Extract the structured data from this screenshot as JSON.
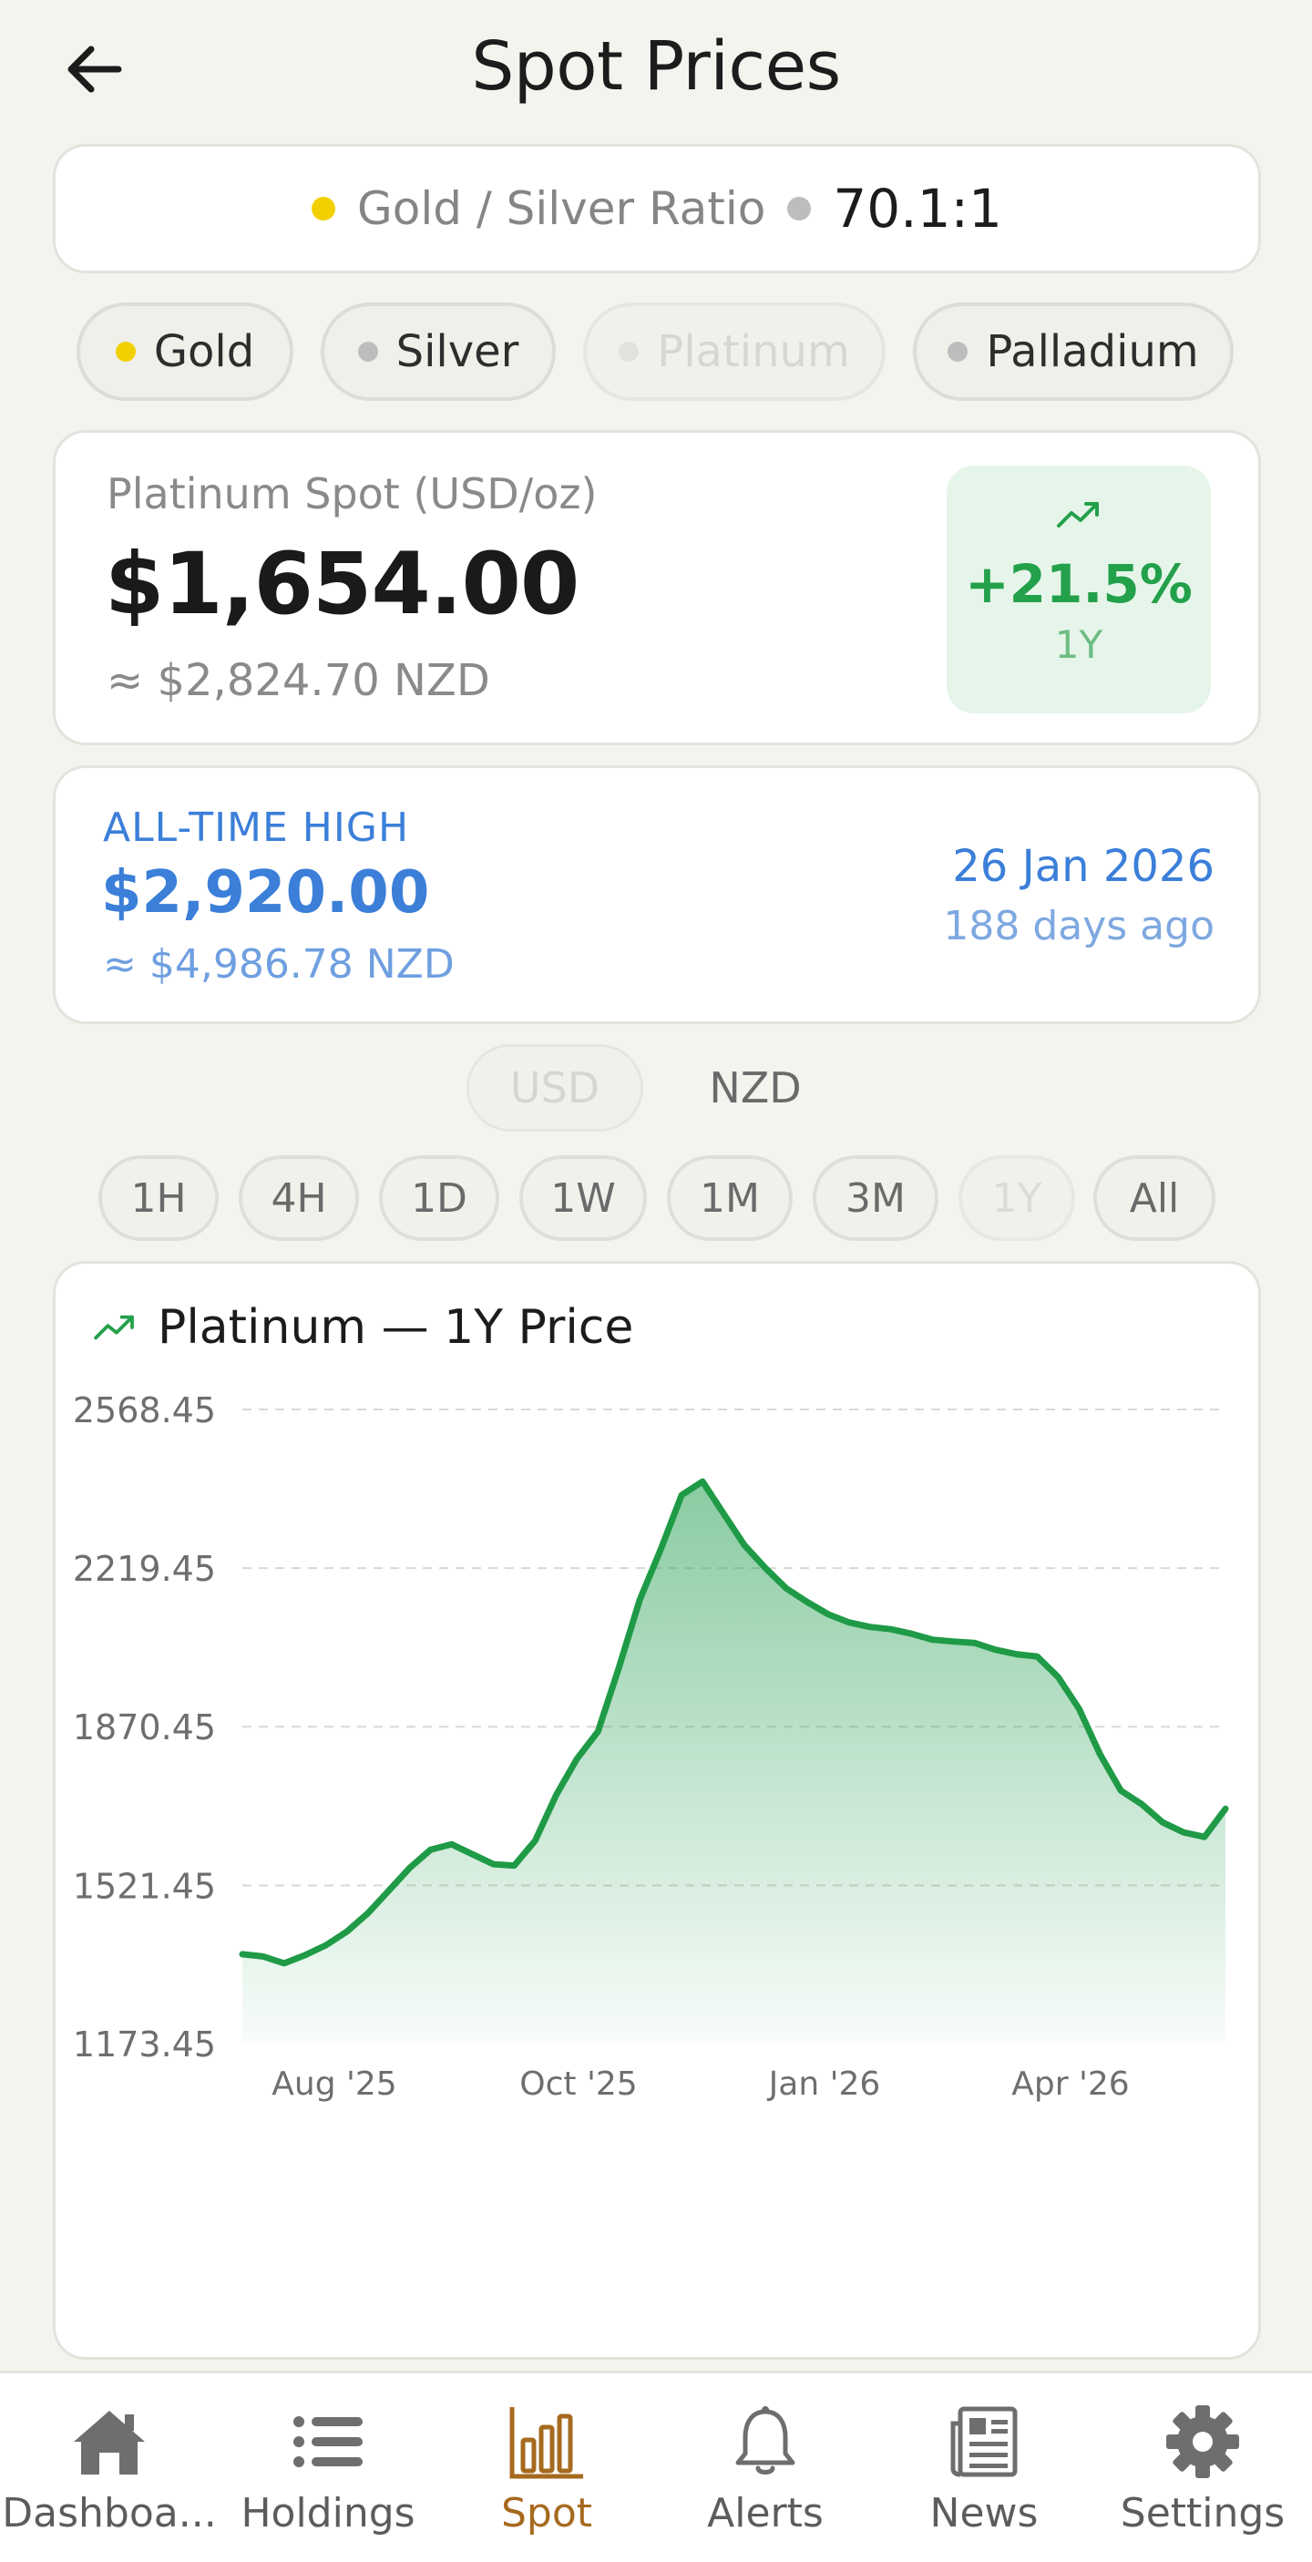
{
  "header": {
    "title": "Spot Prices"
  },
  "ratio": {
    "label": "Gold / Silver Ratio",
    "value": "70.1:1",
    "gold_color": "#f2d000",
    "silver_color": "#bdbdbd"
  },
  "metals": [
    {
      "label": "Gold",
      "dot_color": "#f2d000",
      "selected": false
    },
    {
      "label": "Silver",
      "dot_color": "#bdbdbd",
      "selected": false
    },
    {
      "label": "Platinum",
      "dot_color": "#e2e2dd",
      "selected": true
    },
    {
      "label": "Palladium",
      "dot_color": "#bdbdbd",
      "selected": false
    }
  ],
  "price": {
    "label": "Platinum Spot (USD/oz)",
    "value": "$1,654.00",
    "nzd": "≈ $2,824.70 NZD",
    "change_pct": "+21.5%",
    "change_period": "1Y",
    "change_icon": "trending-up-icon"
  },
  "ath": {
    "label": "ALL-TIME HIGH",
    "value": "$2,920.00",
    "nzd": "≈ $4,986.78 NZD",
    "date": "26 Jan 2026",
    "ago": "188 days ago"
  },
  "currency": {
    "options": [
      "USD",
      "NZD"
    ],
    "selected": "USD"
  },
  "ranges": {
    "options": [
      "1H",
      "4H",
      "1D",
      "1W",
      "1M",
      "3M",
      "1Y",
      "All"
    ],
    "selected": "1Y"
  },
  "colors": {
    "accent_green": "#23a04a",
    "ath_blue": "#3b7fd9",
    "nav_active": "#a66a1f"
  },
  "chart": {
    "title": "Platinum — 1Y Price",
    "icon": "trending-up-icon"
  },
  "chart_data": {
    "type": "area",
    "title": "Platinum — 1Y Price",
    "ylim": [
      1173.45,
      2568.45
    ],
    "y_ticks": [
      "2568.45",
      "2219.45",
      "1870.45",
      "1521.45",
      "1173.45"
    ],
    "x_tick_labels": [
      "Aug '25",
      "Oct '25",
      "Jan '26",
      "Apr '26"
    ],
    "grid": true,
    "series": [
      {
        "values": [
          1370,
          1365,
          1350,
          1368,
          1390,
          1420,
          1460,
          1510,
          1560,
          1600,
          1612,
          1590,
          1568,
          1565,
          1620,
          1720,
          1800,
          1860,
          2000,
          2150,
          2260,
          2380,
          2410,
          2340,
          2270,
          2220,
          2175,
          2145,
          2118,
          2100,
          2090,
          2085,
          2075,
          2062,
          2058,
          2055,
          2040,
          2030,
          2025,
          1980,
          1910,
          1810,
          1730,
          1700,
          1660,
          1638,
          1628,
          1690
        ]
      }
    ]
  },
  "nav": {
    "items": [
      {
        "label": "Dashboa...",
        "icon": "home-icon",
        "active": false
      },
      {
        "label": "Holdings",
        "icon": "list-icon",
        "active": false
      },
      {
        "label": "Spot",
        "icon": "bar-chart-icon",
        "active": true
      },
      {
        "label": "Alerts",
        "icon": "bell-icon",
        "active": false
      },
      {
        "label": "News",
        "icon": "newspaper-icon",
        "active": false
      },
      {
        "label": "Settings",
        "icon": "gear-icon",
        "active": false
      }
    ]
  }
}
